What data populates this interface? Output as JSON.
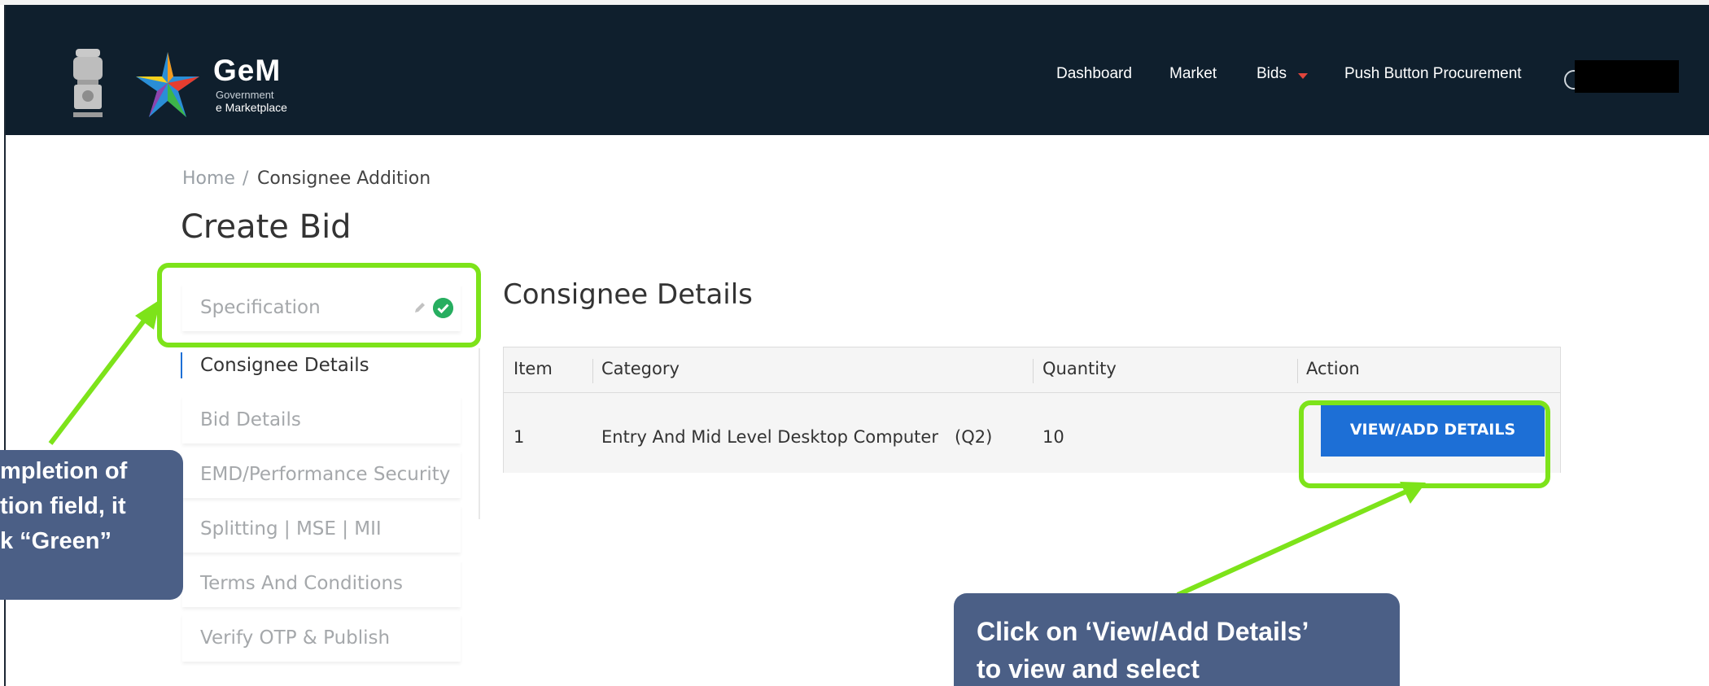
{
  "header": {
    "brand_name": "GeM",
    "brand_sub1": "Government",
    "brand_sub2": "e Marketplace",
    "nav": [
      "Dashboard",
      "Market",
      "Bids",
      "Push Button Procurement"
    ],
    "icons": {
      "emblem": "national-emblem-icon",
      "logo": "gem-star-logo-icon",
      "bids_caret": "caret-down-icon",
      "user": "user-icon"
    }
  },
  "breadcrumb": {
    "home": "Home",
    "separator": "/",
    "current": "Consignee Addition"
  },
  "page_title": "Create Bid",
  "sidebar": {
    "items": [
      {
        "label": "Specification",
        "state": "completed"
      },
      {
        "label": "Consignee Details",
        "state": "active"
      },
      {
        "label": "Bid Details",
        "state": "pending"
      },
      {
        "label": "EMD/Performance Security",
        "state": "pending"
      },
      {
        "label": "Splitting | MSE | MII",
        "state": "pending"
      },
      {
        "label": "Terms And Conditions",
        "state": "pending"
      },
      {
        "label": "Verify OTP & Publish",
        "state": "pending"
      }
    ],
    "icons": {
      "edit": "pencil-icon",
      "done": "check-circle-icon"
    }
  },
  "consignee": {
    "title": "Consignee Details",
    "columns": [
      "Item",
      "Category",
      "Quantity",
      "Action"
    ],
    "rows": [
      {
        "item": "1",
        "category": "Entry And Mid Level Desktop Computer   (Q2)",
        "quantity": "10",
        "action": "VIEW/ADD DETAILS"
      }
    ]
  },
  "callouts": {
    "left_lines": [
      "mpletion of",
      "tion field, it",
      "k “Green”"
    ],
    "right_lines": [
      "Click on ‘View/Add Details’",
      "to view and select"
    ]
  },
  "colors": {
    "header_bg": "#0f1f2d",
    "highlight": "#7de31a",
    "button": "#1d6fd6",
    "callout": "#4b5f86",
    "check": "#27ae60",
    "caret": "#e2453c"
  }
}
